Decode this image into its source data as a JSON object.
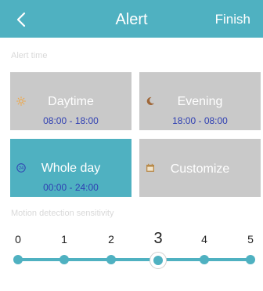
{
  "header": {
    "title": "Alert",
    "finish_label": "Finish",
    "back_icon": "chevron-left-icon",
    "background_color": "#4fb1c1"
  },
  "alert_time": {
    "label": "Alert time",
    "options": [
      {
        "label": "Daytime",
        "range": "08:00 - 18:00",
        "icon": "sun-icon",
        "selected": false
      },
      {
        "label": "Evening",
        "range": "18:00 - 08:00",
        "icon": "moon-icon",
        "selected": false
      },
      {
        "label": "Whole day",
        "range": "00:00 - 24:00",
        "icon": "24-hour-icon",
        "selected": true
      },
      {
        "label": "Customize",
        "range": "",
        "icon": "calendar-icon",
        "selected": false
      }
    ]
  },
  "motion_sensitivity": {
    "label": "Motion detection sensitivity",
    "levels": [
      "0",
      "1",
      "2",
      "3",
      "4",
      "5"
    ],
    "selected_level": 3
  },
  "colors": {
    "accent": "#4fb1c1",
    "tile_inactive": "#c9c9c9",
    "time_range_text": "#2f3fb2",
    "sun_icon": "#f2a33a",
    "moon_icon": "#a0683a",
    "calendar_icon": "#b88a4a"
  }
}
